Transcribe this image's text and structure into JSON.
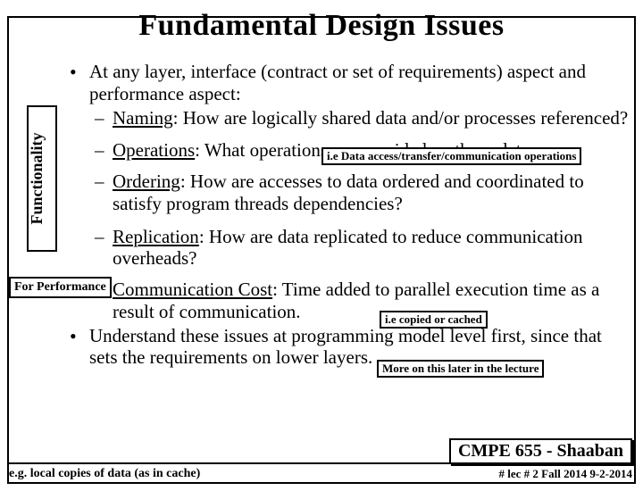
{
  "title": "Fundamental Design Issues",
  "bullet1": "At any layer, interface (contract or set of requirements) aspect and performance aspect:",
  "naming_label": "Naming",
  "naming_text": ":  How are logically shared data and/or processes referenced?",
  "note_data_access": "i.e Data access/transfer/communication operations",
  "operations_label": "Operations",
  "operations_text": ":  What operations are provided on these data.",
  "ordering_label": "Ordering",
  "ordering_text": ":   How are accesses to data ordered and coordinated to satisfy program threads dependencies?",
  "replication_label": "Replication",
  "replication_text": ":   How are data replicated to reduce communication overheads?",
  "note_copied": "i.e copied or cached",
  "commcost_label": "Communication Cost",
  "commcost_text": ": Time added to parallel execution time as a result of communication.",
  "note_more": "More on this later in the lecture",
  "bullet2": "Understand these issues at programming model level first, since that sets the requirements on lower layers.",
  "functionality_label": "Functionality",
  "performance_label": "For Performance",
  "footer_note": "e.g. local copies of data (as in cache)",
  "cmpe": "CMPE 655 - Shaaban",
  "lec": "#  lec # 2    Fall 2014  9-2-2014"
}
